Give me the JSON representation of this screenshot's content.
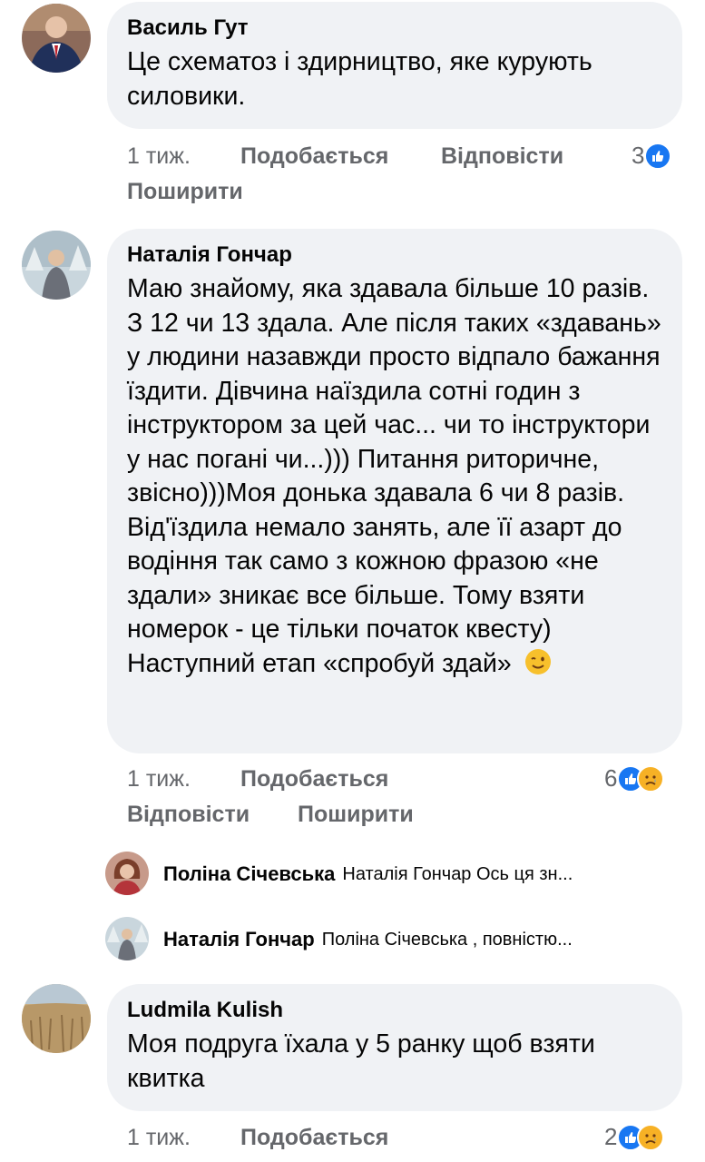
{
  "comments": [
    {
      "author": "Василь Гут",
      "text": "Це схематоз і здирництво, яке курують силовики.",
      "time": "1 тиж.",
      "like_label": "Подобається",
      "reply_label": "Відповісти",
      "share_label": "Поширити",
      "reaction_count": "3"
    },
    {
      "author": "Наталія Гончар",
      "text": "Маю знайому, яка здавала більше 10 разів. З 12 чи 13 здала. Але після таких «здавань» у людини назавжди просто відпало бажання їздити. Дівчина наїздила сотні годин з інструктором за цей час... чи то інструктори у нас погані чи...))) Питання риторичне, звісно)))Моя донька здавала 6 чи 8 разів. Від'їздила немало занять, але її азарт до водіння так само з кожною фразою «не здали» зникає все більше. Тому взяти номерок - це тільки початок квесту) Наступний етап «спробуй здай»",
      "time": "1 тиж.",
      "like_label": "Подобається",
      "reply_label": "Відповісти",
      "share_label": "Поширити",
      "reaction_count": "6"
    },
    {
      "author": "Ludmila Kulish",
      "text": "Моя подруга їхала у 5 ранку щоб взяти квитка",
      "time": "1 тиж.",
      "like_label": "Подобається",
      "reaction_count": "2"
    }
  ],
  "replies": [
    {
      "author": "Поліна Січевська",
      "text": "Наталія Гончар Ось ця зн..."
    },
    {
      "author": "Наталія Гончар",
      "text": "Поліна Січевська , повністю..."
    }
  ],
  "icons": {
    "like": "like-icon",
    "sad": "sad-icon",
    "wink": "wink-emoji-icon"
  },
  "colors": {
    "bubble": "#f0f2f5",
    "meta": "#65676b",
    "like_blue": "#1877f2",
    "sad_yellow": "#f7b125"
  }
}
